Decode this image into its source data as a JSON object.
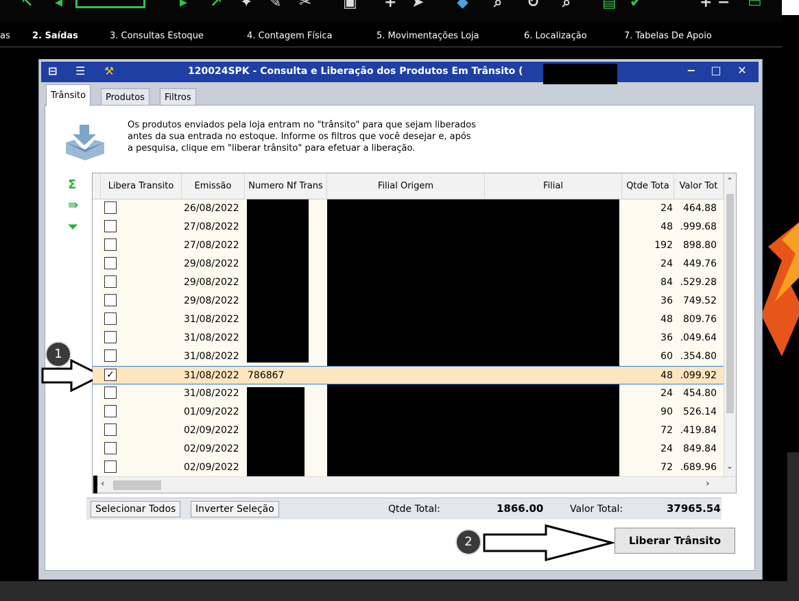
{
  "menu": {
    "items": [
      "as",
      "2. Saídas",
      "3. Consultas Estoque",
      "4. Contagem Física",
      "5. Movimentações Loja",
      "6. Localização",
      "7. Tabelas De Apoio"
    ]
  },
  "dialog": {
    "title": "120024SPK - Consulta e Liberação dos Produtos Em Trânsito (",
    "tabs": [
      "Trânsito",
      "Produtos",
      "Filtros"
    ],
    "intro": "Os produtos enviados pela loja entram no \"trânsito\" para que sejam liberados\nantes da sua entrada no estoque. Informe os filtros que você desejar e, após\na pesquisa, clique em \"liberar trânsito\" para efetuar a liberação.",
    "columns": [
      "Libera Transito",
      "Emissão",
      "Numero Nf Trans",
      "Filial Origem",
      "Filial",
      "Qtde Tota",
      "Valor Tot"
    ],
    "rows": [
      {
        "checked": false,
        "date": "26/08/2022",
        "nf": "",
        "qty": "24",
        "value": " 464.88"
      },
      {
        "checked": false,
        "date": "27/08/2022",
        "nf": "",
        "qty": "48",
        "value": ".999.68"
      },
      {
        "checked": false,
        "date": "27/08/2022",
        "nf": "",
        "qty": "192",
        "value": "898.80"
      },
      {
        "checked": false,
        "date": "29/08/2022",
        "nf": "",
        "qty": "24",
        "value": " 449.76"
      },
      {
        "checked": false,
        "date": "29/08/2022",
        "nf": "",
        "qty": "84",
        "value": ".529.28"
      },
      {
        "checked": false,
        "date": "29/08/2022",
        "nf": "",
        "qty": "36",
        "value": " 749.52"
      },
      {
        "checked": false,
        "date": "31/08/2022",
        "nf": "",
        "qty": "48",
        "value": " 809.76"
      },
      {
        "checked": false,
        "date": "31/08/2022",
        "nf": "",
        "qty": "36",
        "value": ".049.64"
      },
      {
        "checked": false,
        "date": "31/08/2022",
        "nf": "",
        "qty": "60",
        "value": ".354.80"
      },
      {
        "checked": true,
        "date": "31/08/2022",
        "nf": "786867",
        "qty": "48",
        "value": ".099.92"
      },
      {
        "checked": false,
        "date": "31/08/2022",
        "nf": "",
        "qty": "24",
        "value": " 454.80"
      },
      {
        "checked": false,
        "date": "01/09/2022",
        "nf": "",
        "qty": "90",
        "value": "526.14"
      },
      {
        "checked": false,
        "date": "02/09/2022",
        "nf": "",
        "qty": "72",
        "value": ".419.84"
      },
      {
        "checked": false,
        "date": "02/09/2022",
        "nf": "",
        "qty": "24",
        "value": " 849.84"
      },
      {
        "checked": false,
        "date": "02/09/2022",
        "nf": "",
        "qty": "72",
        "value": ".689.96"
      }
    ],
    "footer": {
      "select_all": "Selecionar Todos",
      "invert": "Inverter Seleção",
      "qty_label": "Qtde Total:",
      "qty_value": "1866.00",
      "value_label": "Valor Total:",
      "value_value": "37965.54"
    },
    "release_button": "Liberar Trânsito"
  },
  "annotations": {
    "step1": "1",
    "step2": "2"
  },
  "colors": {
    "toolbar_green": "#2fc44a",
    "title_blue": "#1f3fa3",
    "row_bg": "#fffaf0",
    "row_selected": "#fde5bf"
  }
}
